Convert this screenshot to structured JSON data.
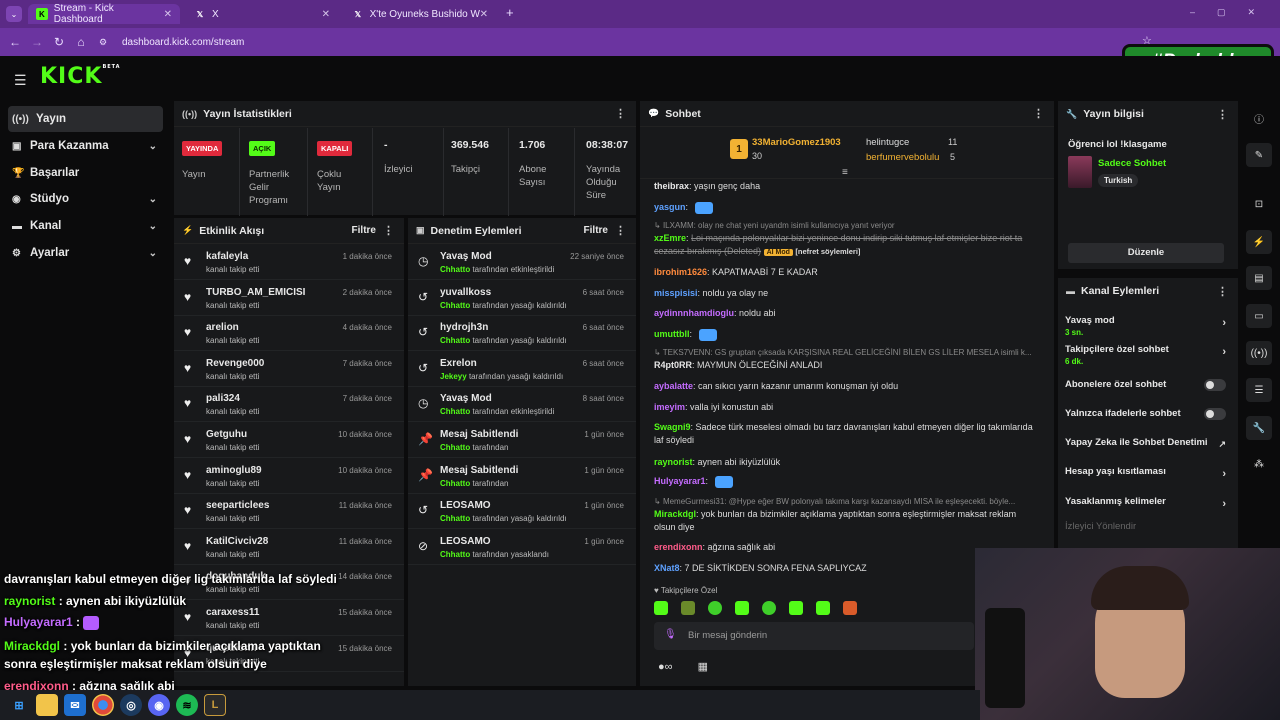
{
  "browser": {
    "tabs": [
      {
        "label": "Stream - Kick Dashboard",
        "icon": "kick-favicon"
      },
      {
        "label": "X",
        "icon": "x-favicon"
      },
      {
        "label": "X'te Oyuneks Bushido Wildcats",
        "icon": "x-favicon"
      }
    ],
    "url": "dashboard.kick.com/stream"
  },
  "overlay_badge": "#Probably",
  "logo": {
    "text": "KICK",
    "tag": "BETA"
  },
  "sidebar": {
    "items": [
      {
        "label": "Yayın",
        "icon": "broadcast-icon",
        "active": true,
        "expandable": false
      },
      {
        "label": "Para Kazanma",
        "icon": "money-icon",
        "active": false,
        "expandable": true
      },
      {
        "label": "Başarılar",
        "icon": "trophy-icon",
        "active": false,
        "expandable": false
      },
      {
        "label": "Stüdyo",
        "icon": "studio-icon",
        "active": false,
        "expandable": true
      },
      {
        "label": "Kanal",
        "icon": "channel-icon",
        "active": false,
        "expandable": true
      },
      {
        "label": "Ayarlar",
        "icon": "gear-icon",
        "active": false,
        "expandable": true
      }
    ]
  },
  "stats": {
    "title": "Yayın İstatistikleri",
    "items": [
      {
        "badge": "YAYINDA",
        "badge_color": "#e02a3c",
        "label": "Yayın"
      },
      {
        "badge": "AÇIK",
        "badge_color": "#53fc18",
        "label": "Partnerlik Gelir Programı"
      },
      {
        "badge": "KAPALI",
        "badge_color": "#e02a3c",
        "label": "Çoklu Yayın"
      },
      {
        "value": "-",
        "label": "İzleyici"
      },
      {
        "value": "369.546",
        "label": "Takipçi"
      },
      {
        "value": "1.706",
        "label": "Abone Sayısı"
      },
      {
        "value": "08:38:07",
        "label": "Yayında Olduğu Süre"
      }
    ]
  },
  "activity": {
    "title": "Etkinlik Akışı",
    "filter": "Filtre",
    "rows": [
      {
        "name": "kafaleyla",
        "sub": "kanalı takip etti",
        "time": "1 dakika önce"
      },
      {
        "name": "TURBO_AM_EMICISI",
        "sub": "kanalı takip etti",
        "time": "2 dakika önce"
      },
      {
        "name": "arelion",
        "sub": "kanalı takip etti",
        "time": "4 dakika önce"
      },
      {
        "name": "Revenge000",
        "sub": "kanalı takip etti",
        "time": "7 dakika önce"
      },
      {
        "name": "pali324",
        "sub": "kanalı takip etti",
        "time": "7 dakika önce"
      },
      {
        "name": "Getguhu",
        "sub": "kanalı takip etti",
        "time": "10 dakika önce"
      },
      {
        "name": "aminoglu89",
        "sub": "kanalı takip etti",
        "time": "10 dakika önce"
      },
      {
        "name": "seeparticlees",
        "sub": "kanalı takip etti",
        "time": "11 dakika önce"
      },
      {
        "name": "KatilCivciv28",
        "sub": "kanalı takip etti",
        "time": "11 dakika önce"
      },
      {
        "name": "doguhanduk",
        "sub": "kanalı takip etti",
        "time": "14 dakika önce"
      },
      {
        "name": "caraxess11",
        "sub": "kanalı takip etti",
        "time": "15 dakika önce"
      },
      {
        "name": "queebionn",
        "sub": "kanalı takip etti",
        "time": "15 dakika önce"
      }
    ]
  },
  "moderation": {
    "title": "Denetim Eylemleri",
    "filter": "Filtre",
    "rows": [
      {
        "icon": "slow-mode-icon",
        "name": "Yavaş Mod",
        "actor": "Chhatto",
        "sub": "tarafından etkinleştirildi",
        "time": "22 saniye önce"
      },
      {
        "icon": "undo-icon",
        "name": "yuvallkoss",
        "actor": "Chhatto",
        "sub": "tarafından yasağı kaldırıldı",
        "time": "6 saat önce"
      },
      {
        "icon": "undo-icon",
        "name": "hydrojh3n",
        "actor": "Chhatto",
        "sub": "tarafından yasağı kaldırıldı",
        "time": "6 saat önce"
      },
      {
        "icon": "undo-icon",
        "name": "Exrelon",
        "actor": "Jekeyy",
        "sub": "tarafından yasağı kaldırıldı",
        "time": "6 saat önce"
      },
      {
        "icon": "slow-mode-icon",
        "name": "Yavaş Mod",
        "actor": "Chhatto",
        "sub": "tarafından etkinleştirildi",
        "time": "8 saat önce"
      },
      {
        "icon": "pin-icon",
        "name": "Mesaj Sabitlendi",
        "actor": "Chhatto",
        "sub": "tarafından",
        "time": "1 gün önce"
      },
      {
        "icon": "pin-icon",
        "name": "Mesaj Sabitlendi",
        "actor": "Chhatto",
        "sub": "tarafından",
        "time": "1 gün önce"
      },
      {
        "icon": "undo-icon",
        "name": "LEOSAMO",
        "actor": "Chhatto",
        "sub": "tarafından yasağı kaldırıldı",
        "time": "1 gün önce"
      },
      {
        "icon": "ban-icon",
        "name": "LEOSAMO",
        "actor": "Chhatto",
        "sub": "tarafından yasaklandı",
        "time": "1 gün önce"
      }
    ]
  },
  "chat": {
    "title": "Sohbet",
    "leaderboard": {
      "top": {
        "rank": "1",
        "name": "33MarioGomez1903",
        "count": "30"
      },
      "second": {
        "name": "helintugce",
        "count": "11"
      },
      "third": {
        "name": "berfumervebolulu",
        "count": "5"
      }
    },
    "messages": [
      {
        "user": "theibrax",
        "color": "#e8e8e8",
        "text": "yaşın genç daha"
      },
      {
        "user": "yasgun",
        "color": "#5ea1ff",
        "text": ""
      },
      {
        "reply": "ILXAMM: olay ne chat yeni uyandm isimli kullanıcıya yanıt veriyor"
      },
      {
        "user": "xzEmre",
        "color": "#53fc18",
        "text": "Loi maçında polonyalılar bizi yenince donu indirip siki tutmuş laf etmişler bize riot ta cezasız bırakmış (Deleted)",
        "tag": "AI Mod",
        "tag2": "[nefret söylemleri]"
      },
      {
        "user": "ibrohim1626",
        "color": "#ff8a3d",
        "text": "KAPATMAABİ 7 E KADAR"
      },
      {
        "user": "misspisisi",
        "color": "#5ea1ff",
        "text": "noldu ya olay ne"
      },
      {
        "user": "aydinnnhamdioglu",
        "color": "#c46cff",
        "text": "noldu abi"
      },
      {
        "user": "umuttbll",
        "color": "#53fc18",
        "text": ""
      },
      {
        "reply": "TEKS7VENN: GS gruptan çıksada KARŞISINA REAL GELİCEĞİNİ BİLEN GS LİLER MESELA isimli k..."
      },
      {
        "user": "R4pt0RR",
        "color": "#e8e8e8",
        "text": "MAYMUN ÖLECEĞİNİ ANLADI"
      },
      {
        "user": "aybalatte",
        "color": "#c46cff",
        "text": "can sıkıcı yarın kazanır umarım konuşman iyi oldu"
      },
      {
        "user": "imeyim",
        "color": "#c46cff",
        "text": "valla iyi konustun abi"
      },
      {
        "user": "Swagni9",
        "color": "#53fc18",
        "text": "Sadece türk meselesi olmadı bu tarz davranışları kabul etmeyen diğer lig takımlarıda laf söyledi"
      },
      {
        "user": "raynorist",
        "color": "#53fc18",
        "text": "aynen abi ikiyüzlülük"
      },
      {
        "user": "Hulyayarar1",
        "color": "#c46cff",
        "text": ""
      },
      {
        "reply": "MemeGurmesi31: @Hype eğer BW polonyalı takıma karşı kazansaydı MISA ile eşleşecekti. böyle..."
      },
      {
        "user": "Mirackdgl",
        "color": "#53fc18",
        "text": "yok bunları da bizimkiler açıklama yaptıktan sonra eşleştirmişler maksat reklam olsun diye"
      },
      {
        "user": "erendixonn",
        "color": "#ff5c8a",
        "text": "ağzına sağlık abi"
      },
      {
        "user": "XNat8",
        "color": "#5ea1ff",
        "text": "7 DE SİKTİKDEN SONRA FENA SAPLIYCAZ"
      }
    ],
    "followers_only_label": "Takipçilere Özel",
    "input_placeholder": "Bir mesaj gönderin"
  },
  "stream_info": {
    "title": "Yayın bilgisi",
    "stream_title": "Öğrenci lol !klasgame",
    "category": "Sadece Sohbet",
    "language_tag": "Turkish",
    "edit_button": "Düzenle"
  },
  "channel_actions": {
    "title": "Kanal Eylemleri",
    "items": [
      {
        "label": "Yavaş mod",
        "sub": "3 sn.",
        "control": "chevron"
      },
      {
        "label": "Takipçilere özel sohbet",
        "sub": "6 dk.",
        "control": "chevron"
      },
      {
        "label": "Abonelere özel sohbet",
        "sub": "",
        "control": "toggle"
      },
      {
        "label": "Yalnızca ifadelerle sohbet",
        "sub": "",
        "control": "toggle"
      },
      {
        "label": "Yapay Zeka ile Sohbet Denetimi",
        "sub": "",
        "control": "external"
      },
      {
        "label": "Hesap yaşı kısıtlaması",
        "sub": "",
        "control": "chevron"
      },
      {
        "label": "Yasaklanmış kelimeler",
        "sub": "",
        "control": "chevron"
      }
    ],
    "faded_item": "İzleyici Yönlendir"
  },
  "overlay_chat": [
    {
      "user": "",
      "text": "davranışları kabul etmeyen diğer lig takımlarıda laf söyledi",
      "color": "#ffffff"
    },
    {
      "user": "raynorist",
      "text": "aynen abi ikiyüzlülük",
      "color": "#53fc18"
    },
    {
      "user": "Hulyayarar1",
      "text": "",
      "color": "#c46cff"
    },
    {
      "user": "Mirackdgl",
      "text": "yok bunları da bizimkiler açıklama yaptıktan",
      "color": "#53fc18"
    },
    {
      "user": "",
      "text": "sonra eşleştirmişler maksat reklam olsun diye",
      "color": "#ffffff"
    },
    {
      "user": "erendixonn",
      "text": "ağzına sağlık abi",
      "color": "#ff5c8a"
    }
  ],
  "taskbar": {
    "icons": [
      "windows-icon",
      "folder-icon",
      "mail-icon",
      "chrome-icon",
      "steam-icon",
      "discord-icon",
      "spotify-icon",
      "league-icon"
    ]
  },
  "colors": {
    "accent": "#53fc18",
    "panel": "#18191b",
    "background": "#0b0b0c",
    "browser": "#6b34a0"
  }
}
